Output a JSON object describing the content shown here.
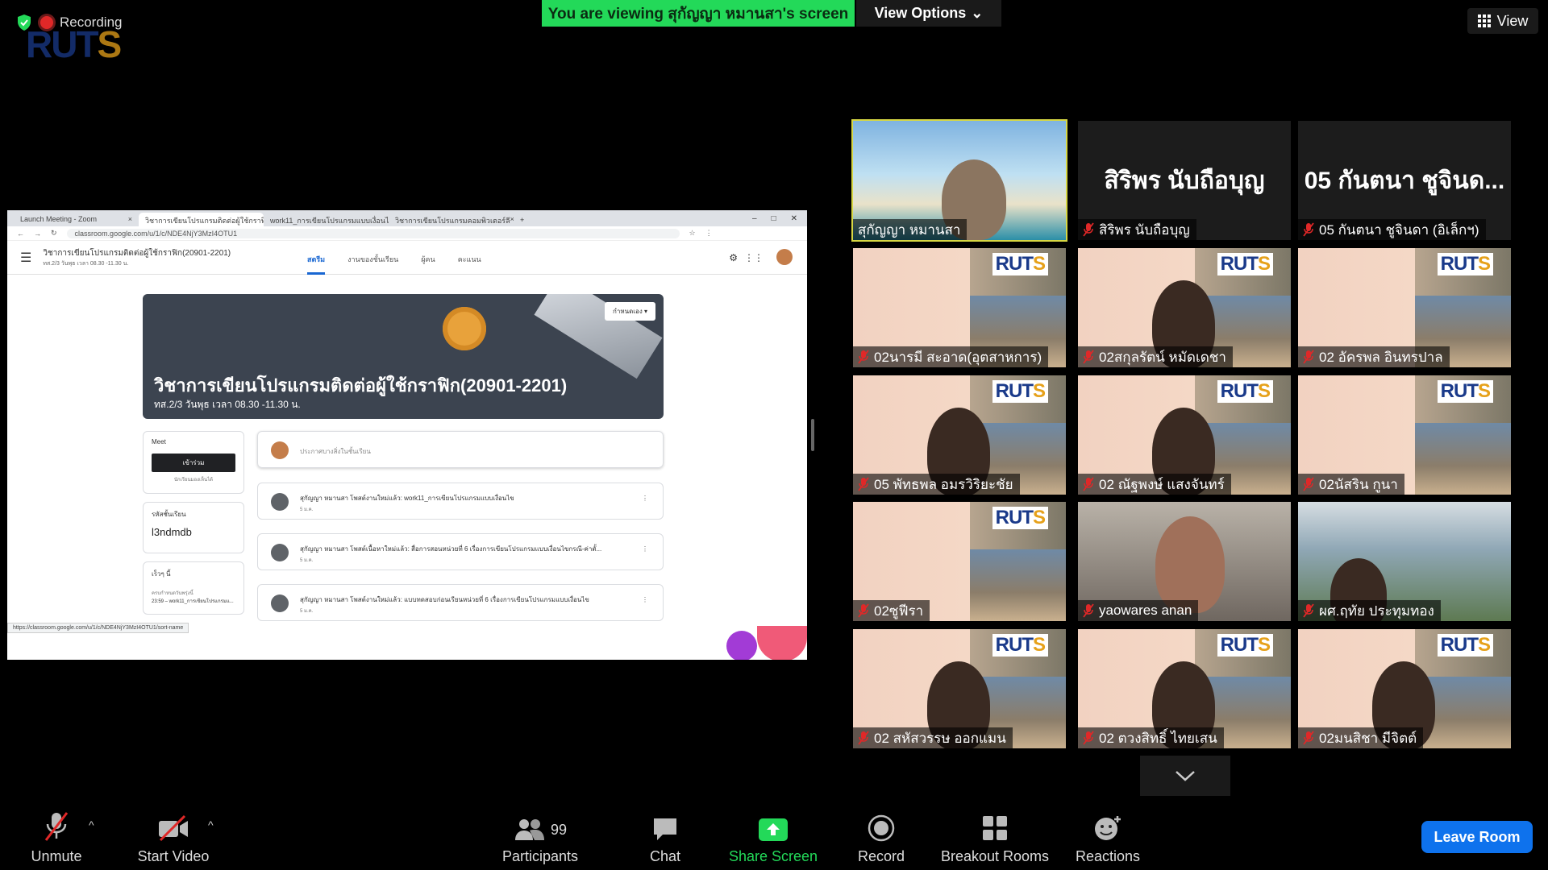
{
  "recording": {
    "label": "Recording"
  },
  "viewing_banner": "You are viewing สุกัญญา หมานสา's screen",
  "view_options": "View Options",
  "view_button": "View",
  "browser": {
    "tabs": [
      "Launch Meeting - Zoom",
      "วิชาการเขียนโปรแกรมติดต่อผู้ใช้กราฟิ",
      "work11_การเขียนโปรแกรมแบบเงื่อนไข",
      "วิชาการเขียนโปรแกรมคอมพิวเตอร์ลี"
    ],
    "url": "classroom.google.com/u/1/c/NDE4NjY3MzI4OTU1",
    "status_url": "https://classroom.google.com/u/1/c/NDE4NjY3MzI4OTU1/sort-name"
  },
  "classroom": {
    "title": "วิชาการเขียนโปรแกรมติดต่อผู้ใช้กราฟิก(20901-2201)",
    "subtitle": "ทส.2/3 วันพุธ เวลา 08.30 -11.30 น.",
    "tabs": [
      "สตรีม",
      "งานของชั้นเรียน",
      "ผู้คน",
      "คะแนน"
    ],
    "banner_title": "วิชาการเขียนโปรแกรมติดต่อผู้ใช้กราฟิก(20901-2201)",
    "banner_subtitle": "ทส.2/3 วันพุธ เวลา 08.30 -11.30 น.",
    "customize": "กำหนดเอง",
    "meet_label": "Meet",
    "join_label": "เข้าร่วม",
    "meet_note": "นักเรียนมองเห็นได้",
    "class_code_label": "รหัสชั้นเรียน",
    "class_code": "l3ndmdb",
    "upcoming_label": "เร็วๆ นี้",
    "upcoming_due": "ครบกำหนดวันพรุ่งนี้",
    "upcoming_item": "23:59 – work11_การเขียนโปรแกรมแ...",
    "announce_placeholder": "ประกาศบางสิ่งในชั้นเรียน",
    "posts": [
      {
        "text": "สุกัญญา หมานสา โพสต์งานใหม่แล้ว: work11_การเขียนโปรแกรมแบบเงื่อนไข",
        "date": "5 ม.ค."
      },
      {
        "text": "สุกัญญา หมานสา โพสต์เนื้อหาใหม่แล้ว: สื่อการสอนหน่วยที่ 6 เรื่องการเขียนโปรแกรมแบบเงื่อนไขกรณี-ค่าตั้...",
        "date": "5 ม.ค."
      },
      {
        "text": "สุกัญญา หมานสา โพสต์งานใหม่แล้ว: แบบทดสอบก่อนเรียนหน่วยที่ 6 เรื่องการเขียนโปรแกรมแบบเงื่อนไข",
        "date": "5 ม.ค."
      }
    ]
  },
  "participants": [
    {
      "name": "สุกัญญา หมานสา",
      "kind": "video",
      "muted": false
    },
    {
      "name": "สิริพร นับถือบุญ",
      "kind": "name",
      "big": "สิริพร นับถือบุญ",
      "muted": true
    },
    {
      "name": "05 กันตนา ชูจินดา (อิเล็กฯ)",
      "kind": "name",
      "big": "05 กันตนา ชูจินด...",
      "muted": true
    },
    {
      "name": "02นารมี สะอาด(อุตสาหการ)",
      "kind": "slide",
      "muted": true
    },
    {
      "name": "02สกุลรัตน์ หมัดเดชา",
      "kind": "slide-face",
      "muted": true
    },
    {
      "name": "02 อัครพล อินทรปาล",
      "kind": "slide",
      "muted": true
    },
    {
      "name": "05 พัทธพล อมรวิริยะชัย",
      "kind": "slide-face",
      "muted": true
    },
    {
      "name": "02 ณัฐพงษ์ แสงจันทร์",
      "kind": "slide-face",
      "muted": true
    },
    {
      "name": "02นัสริน กูนา",
      "kind": "slide",
      "muted": true
    },
    {
      "name": "02ซูฟีรา",
      "kind": "slide",
      "muted": true
    },
    {
      "name": "yaowares anan",
      "kind": "face",
      "muted": true
    },
    {
      "name": "ผศ.ฤทัย ประทุมทอง",
      "kind": "building",
      "muted": true
    },
    {
      "name": "02 สหัสวรรษ ออกแมน",
      "kind": "slide-face",
      "muted": true
    },
    {
      "name": "02 ตวงสิทธิ์ ไทยเสน",
      "kind": "slide-face",
      "muted": true
    },
    {
      "name": "02มนสิชา มีจิตต์",
      "kind": "slide-face",
      "muted": true
    }
  ],
  "toolbar": {
    "unmute": "Unmute",
    "start_video": "Start Video",
    "participants": "Participants",
    "participants_count": "99",
    "chat": "Chat",
    "share_screen": "Share Screen",
    "record": "Record",
    "breakout_rooms": "Breakout Rooms",
    "reactions": "Reactions",
    "leave": "Leave Room"
  },
  "colors": {
    "share_green": "#23d959",
    "leave_blue": "#0e72ed",
    "speaker_outline": "#d7d744"
  }
}
